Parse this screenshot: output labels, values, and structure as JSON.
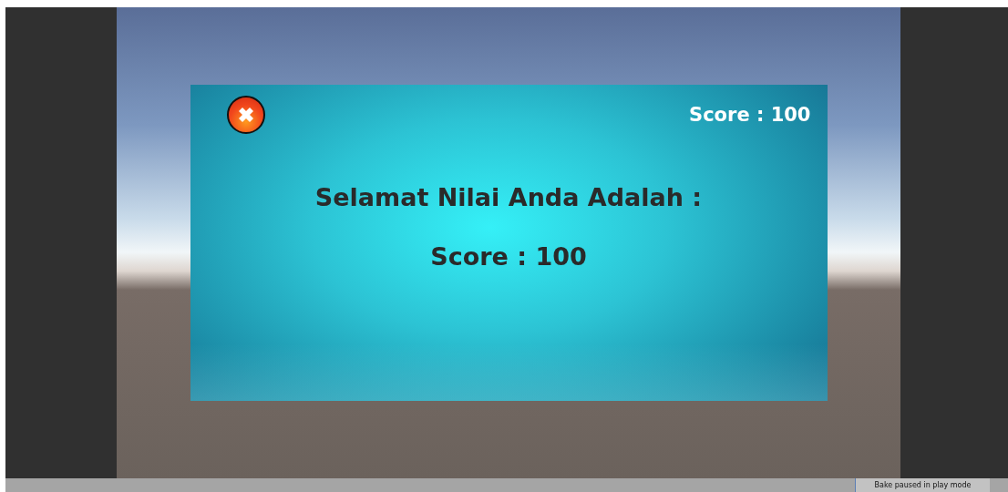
{
  "dialog": {
    "close_button": {
      "kind": "close"
    },
    "score_corner": "Score : 100",
    "message": "Selamat Nilai Anda Adalah :",
    "score": "Score : 100"
  },
  "status_bar": {
    "message": "Bake paused in play mode"
  }
}
